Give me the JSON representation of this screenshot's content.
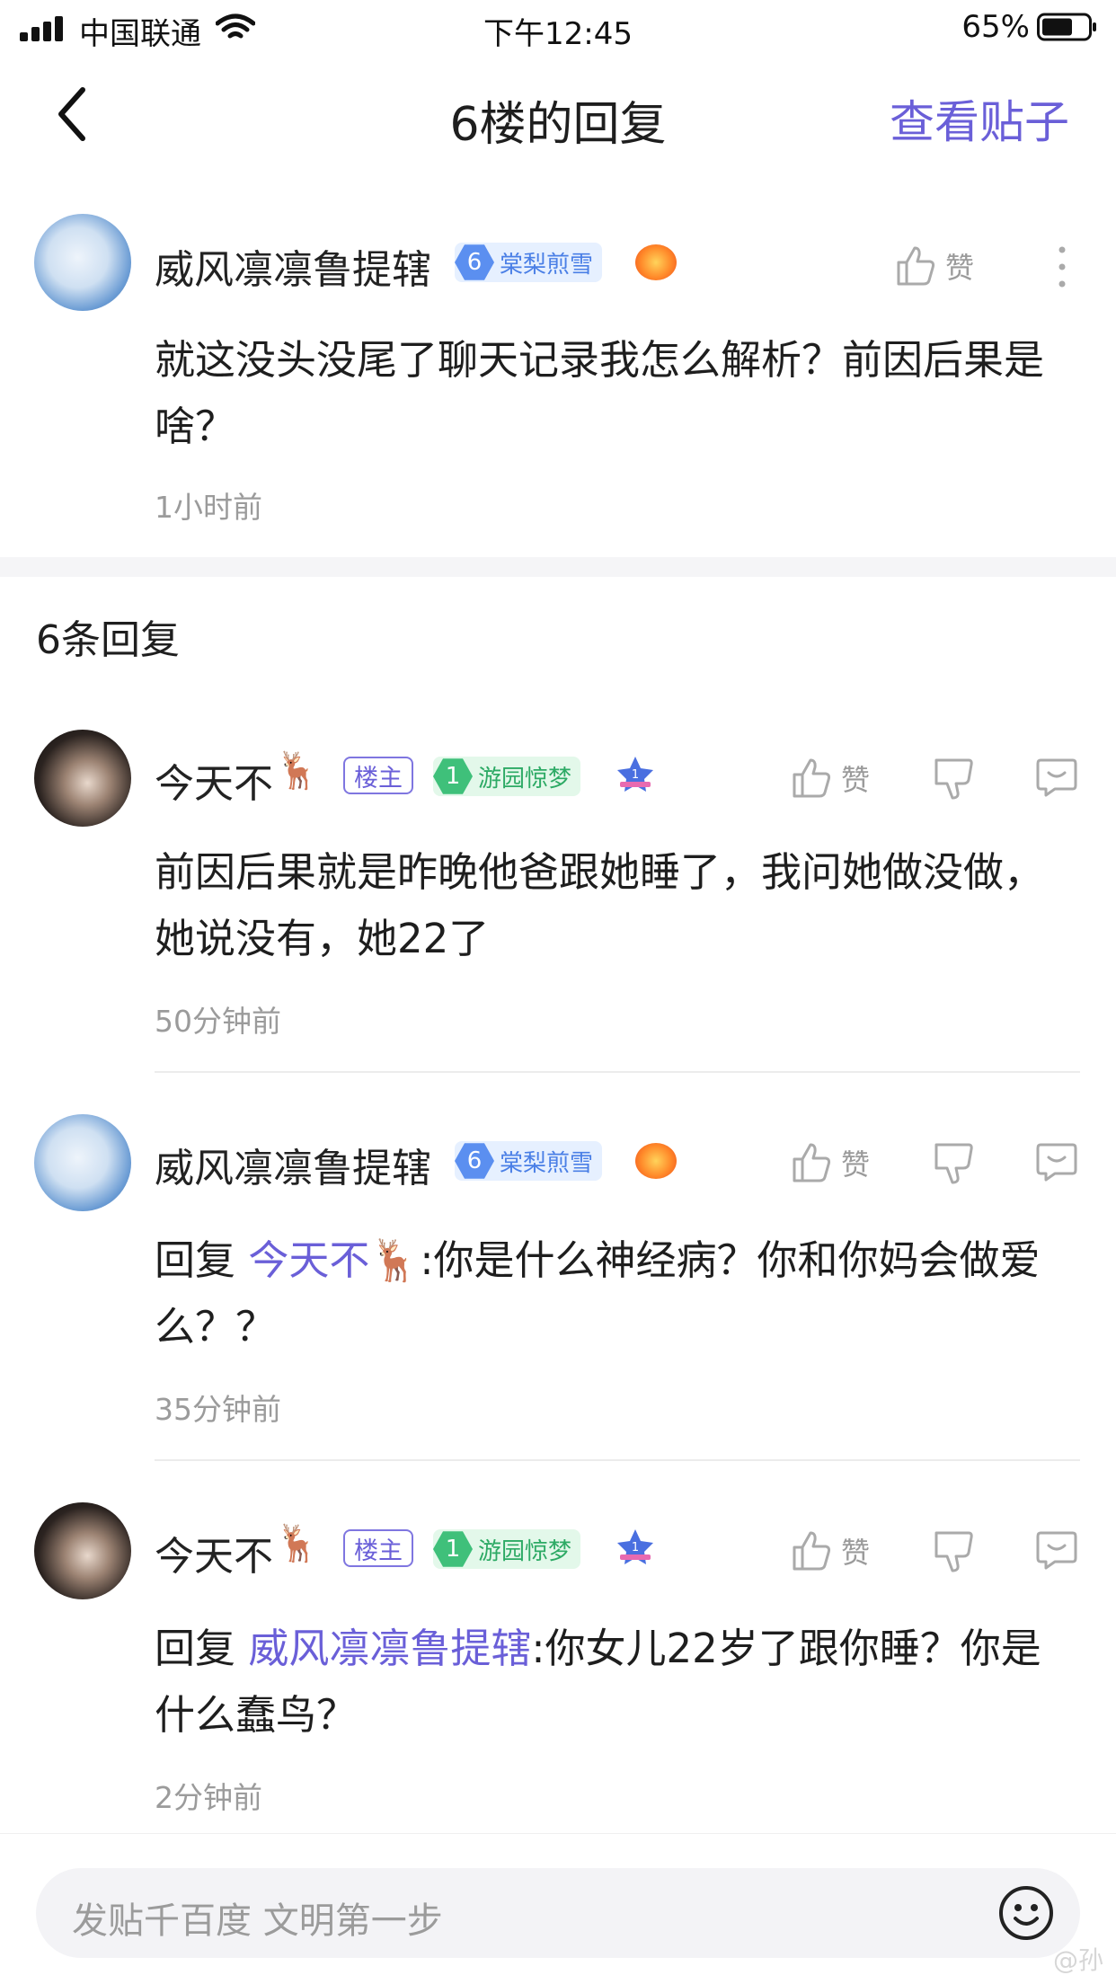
{
  "status_bar": {
    "carrier": "中国联通",
    "time": "下午12:45",
    "battery": "65%"
  },
  "nav": {
    "title": "6楼的回复",
    "action": "查看贴子"
  },
  "main_post": {
    "username": "威风凛凛鲁提辖",
    "level": "6",
    "level_name": "棠梨煎雪",
    "like_label": "赞",
    "content": "就这没头没尾了聊天记录我怎么解析？前因后果是啥？",
    "time": "1小时前"
  },
  "replies_count": "6条回复",
  "replies": [
    {
      "username": "今天不",
      "owner_badge": "楼主",
      "level": "1",
      "level_name": "游园惊梦",
      "like_label": "赞",
      "content": "前因后果就是昨晚他爸跟她睡了，我问她做没做，她说没有，她22了",
      "time": "50分钟前"
    },
    {
      "username": "威风凛凛鲁提辖",
      "level": "6",
      "level_name": "棠梨煎雪",
      "like_label": "赞",
      "reply_prefix": "回复 ",
      "mention": "今天不",
      "content": ":你是什么神经病？你和你妈会做爱么？？",
      "time": "35分钟前"
    },
    {
      "username": "今天不",
      "owner_badge": "楼主",
      "level": "1",
      "level_name": "游园惊梦",
      "like_label": "赞",
      "reply_prefix": "回复 ",
      "mention": "威风凛凛鲁提辖",
      "content": ":你女儿22岁了跟你睡？你是什么蠢鸟？",
      "time": "2分钟前"
    }
  ],
  "input": {
    "placeholder": "发贴千百度 文明第一步"
  },
  "watermark": "@孙"
}
